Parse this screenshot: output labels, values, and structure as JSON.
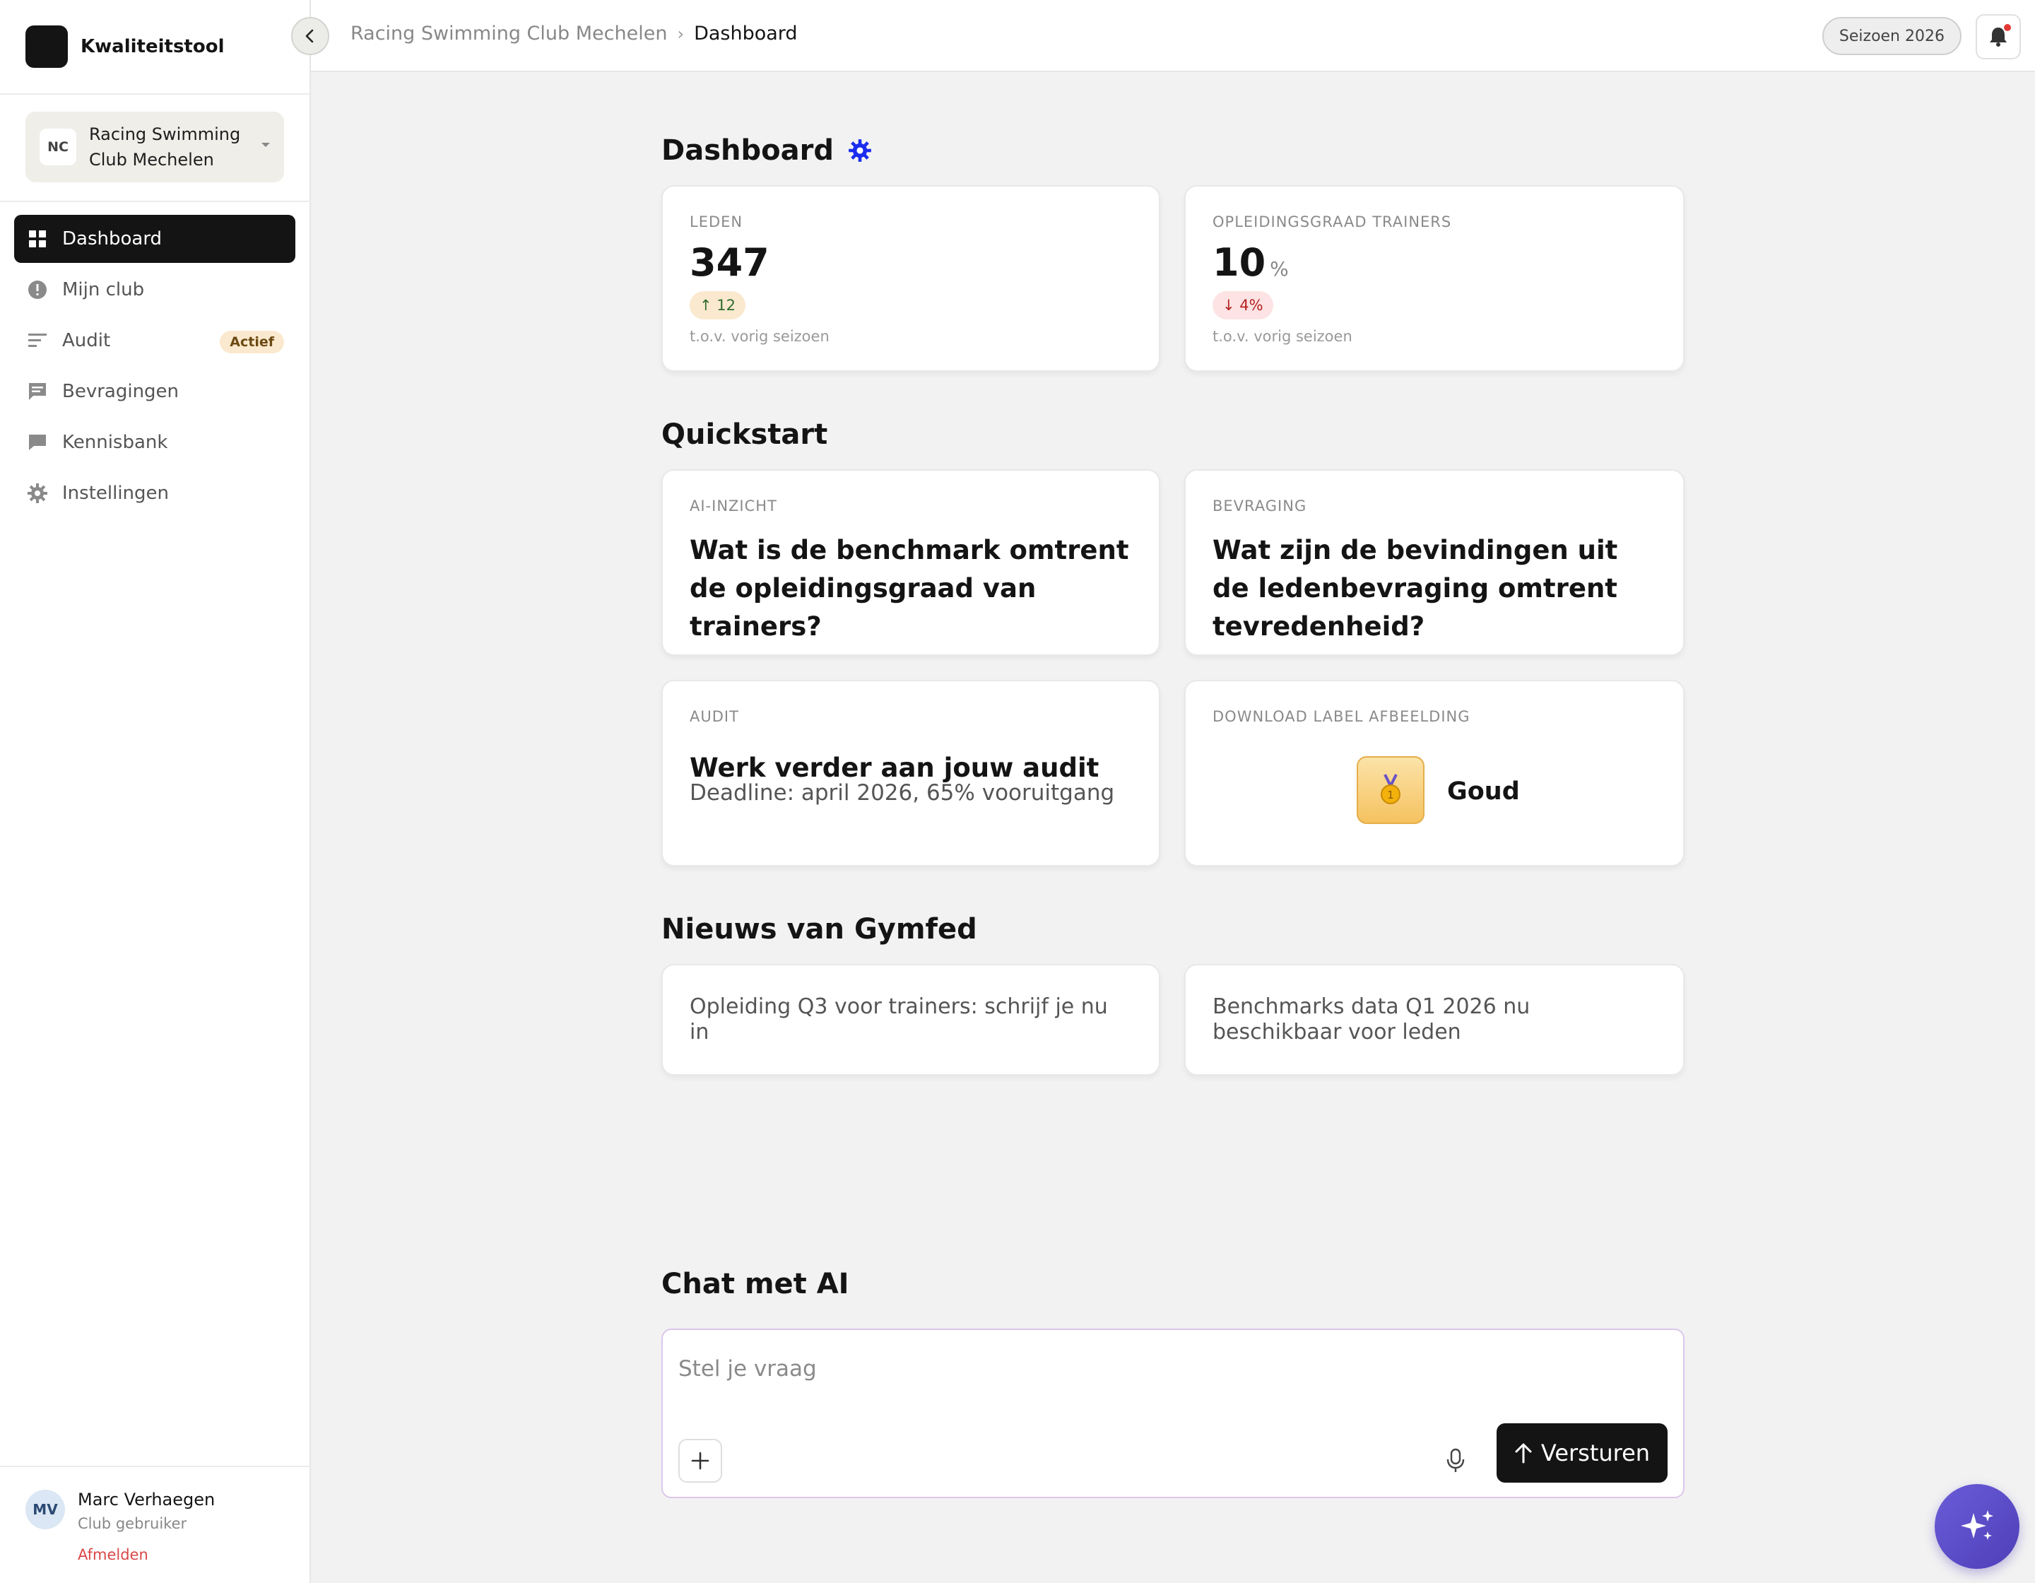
{
  "sidebar": {
    "brand": "Kwaliteitstool",
    "club": {
      "initials": "NC",
      "name": "Racing Swimming Club Mechelen"
    },
    "items": [
      {
        "label": "Dashboard",
        "icon": "grid-icon",
        "active": true
      },
      {
        "label": "Mijn club",
        "icon": "info-circle-icon"
      },
      {
        "label": "Audit",
        "icon": "list-icon",
        "badge": "Actief"
      },
      {
        "label": "Bevragingen",
        "icon": "message-icon"
      },
      {
        "label": "Kennisbank",
        "icon": "chat-bubble-icon"
      },
      {
        "label": "Instellingen",
        "icon": "gear-icon"
      }
    ],
    "user": {
      "initials": "MV",
      "name": "Marc Verhaegen",
      "role": "Club gebruiker",
      "logout": "Afmelden"
    }
  },
  "topbar": {
    "breadcrumb": [
      "Racing Swimming Club Mechelen",
      "Dashboard"
    ],
    "breadcrumb_separator": "›",
    "season": "Seizoen 2026"
  },
  "dashboard": {
    "title": "Dashboard",
    "stats": [
      {
        "label": "LEDEN",
        "value": "347",
        "unit": "",
        "change": "↑ 12",
        "direction": "up",
        "note": "t.o.v. vorig seizoen"
      },
      {
        "label": "OPLEIDINGSGRAAD TRAINERS",
        "value": "10",
        "unit": "%",
        "change": "↓ 4%",
        "direction": "down",
        "note": "t.o.v. vorig seizoen"
      }
    ]
  },
  "quickstart": {
    "title": "Quickstart",
    "cards": [
      {
        "label": "AI-INZICHT",
        "title": "Wat is de benchmark omtrent de opleidingsgraad van trainers?"
      },
      {
        "label": "BEVRAGING",
        "title": "Wat zijn de bevindingen uit de ledenbevraging omtrent tevredenheid?"
      },
      {
        "label": "AUDIT",
        "title": "Werk verder aan jouw audit",
        "subtitle": "Deadline: april 2026, 65% vooruitgang"
      },
      {
        "label": "DOWNLOAD LABEL AFBEELDING",
        "badge": "Goud",
        "icon": "gold-medal-icon"
      }
    ]
  },
  "news": {
    "title": "Nieuws van Gymfed",
    "items": [
      "Opleiding Q3 voor trainers: schrijf je nu in",
      "Benchmarks data Q1 2026 nu beschikbaar voor leden"
    ]
  },
  "chat": {
    "title": "Chat met AI",
    "placeholder": "Stel je vraag",
    "send": "Versturen"
  },
  "colors": {
    "accent_dark": "#141414",
    "badge_bg": "#fbe9cf",
    "up": "#2e6b2e",
    "down": "#b32121",
    "gear_blue": "#1a2cf0",
    "fab": "#5a4ac8",
    "logout": "#d94848"
  }
}
